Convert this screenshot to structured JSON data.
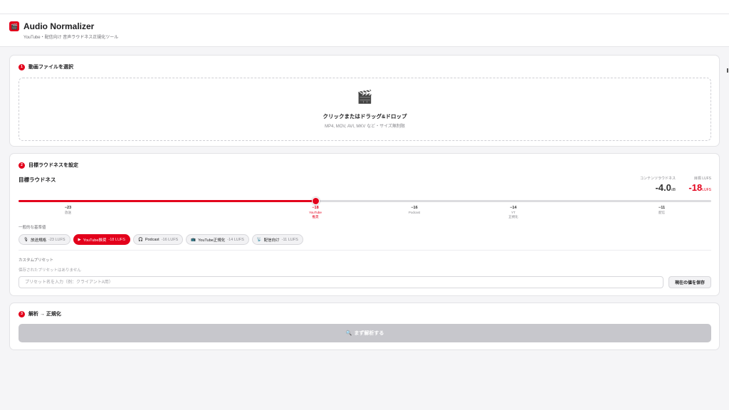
{
  "header": {
    "title": "Audio Normalizer",
    "subtitle": "YouTube・配信向け 音声ラウドネス正規化ツール"
  },
  "step1": {
    "number": "1",
    "title": "動画ファイルを選択",
    "drop_icon": "🎬",
    "drop_main": "クリックまたはドラッグ&ドロップ",
    "drop_sub": "MP4, MOV, AVI, MKV など・サイズ無制限"
  },
  "step2": {
    "number": "2",
    "title": "目標ラウドネスを設定",
    "target_label": "目標ラウドネス",
    "content_loudness_label": "コンテンツラウドネス",
    "content_loudness_value": "-4.0",
    "content_loudness_unit": "dB",
    "target_lufs_label": "目標 LUFS",
    "target_lufs_value": "-18",
    "target_lufs_unit": "LUFS",
    "slider": {
      "min": -24,
      "max": -10,
      "value": -18
    },
    "ticks": [
      {
        "value": -23,
        "label": "−23",
        "name": "放送"
      },
      {
        "value": -18,
        "label": "−18",
        "name": "YouTube\n推奨",
        "active": true
      },
      {
        "value": -16,
        "label": "−16",
        "name": "Podcast"
      },
      {
        "value": -14,
        "label": "−14",
        "name": "YT\n正規化"
      },
      {
        "value": -11,
        "label": "−11",
        "name": "配信"
      }
    ],
    "presets_label": "一般的な基準値",
    "presets": [
      {
        "icon": "🎙",
        "icon_name": "microphone-icon",
        "name": "放送規格",
        "unit": "-23 LUFS",
        "active": false
      },
      {
        "icon": "▶",
        "icon_name": "play-icon",
        "name": "YouTube推奨",
        "unit": "-18 LUFS",
        "active": true
      },
      {
        "icon": "🎧",
        "icon_name": "headphones-icon",
        "name": "Podcast",
        "unit": "-16 LUFS",
        "active": false
      },
      {
        "icon": "📺",
        "icon_name": "tv-icon",
        "name": "YouTube正規化",
        "unit": "-14 LUFS",
        "active": false
      },
      {
        "icon": "📡",
        "icon_name": "antenna-icon",
        "name": "配信向け",
        "unit": "-11 LUFS",
        "active": false
      }
    ],
    "custom_label": "カスタムプリセット",
    "custom_empty": "保存されたプリセットはありません",
    "custom_placeholder": "プリセット名を入力（例：クライアントA用）",
    "save_button": "現在の値を保存"
  },
  "step3": {
    "number": "3",
    "title": "解析 → 正規化",
    "button_icon": "🔍",
    "button_label": "まず解析する"
  },
  "colors": {
    "accent": "#e3001b",
    "background": "#f5f5f7",
    "disabled_button": "#c7c7cc"
  }
}
